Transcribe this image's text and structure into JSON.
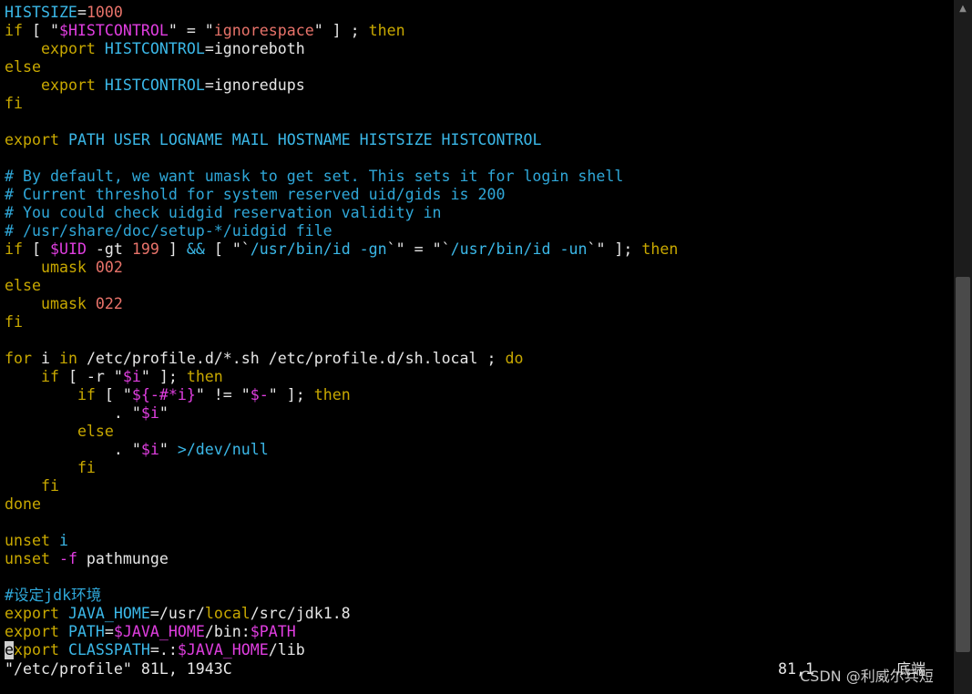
{
  "theme": {
    "background": "#000000",
    "colors": {
      "t": "#e6e6e6",
      "k": "#c8a800",
      "v": "#3bb8e8",
      "s": "#e8736a",
      "p": "#e03ee0",
      "n": "#e8736a",
      "c": "#2fa7d8",
      "o": "#cfcfcf"
    }
  },
  "editor": {
    "lines": [
      [
        [
          "v",
          "HISTSIZE"
        ],
        [
          "t",
          "="
        ],
        [
          "n",
          "1000"
        ]
      ],
      [
        [
          "k",
          "if"
        ],
        [
          "t",
          " [ \""
        ],
        [
          "p",
          "$HISTCONTROL"
        ],
        [
          "t",
          "\" = \""
        ],
        [
          "s",
          "ignorespace"
        ],
        [
          "t",
          "\" ] ; "
        ],
        [
          "k",
          "then"
        ]
      ],
      [
        [
          "t",
          "    "
        ],
        [
          "k",
          "export"
        ],
        [
          "t",
          " "
        ],
        [
          "v",
          "HISTCONTROL"
        ],
        [
          "t",
          "=ignoreboth"
        ]
      ],
      [
        [
          "k",
          "else"
        ]
      ],
      [
        [
          "t",
          "    "
        ],
        [
          "k",
          "export"
        ],
        [
          "t",
          " "
        ],
        [
          "v",
          "HISTCONTROL"
        ],
        [
          "t",
          "=ignoredups"
        ]
      ],
      [
        [
          "k",
          "fi"
        ]
      ],
      [],
      [
        [
          "k",
          "export"
        ],
        [
          "t",
          " "
        ],
        [
          "v",
          "PATH USER LOGNAME MAIL HOSTNAME HISTSIZE HISTCONTROL"
        ]
      ],
      [],
      [
        [
          "c",
          "# By default, we want umask to get set. This sets it for login shell"
        ]
      ],
      [
        [
          "c",
          "# Current threshold for system reserved uid/gids is 200"
        ]
      ],
      [
        [
          "c",
          "# You could check uidgid reservation validity in"
        ]
      ],
      [
        [
          "c",
          "# /usr/share/doc/setup-*/uidgid file"
        ]
      ],
      [
        [
          "k",
          "if"
        ],
        [
          "t",
          " [ "
        ],
        [
          "p",
          "$UID"
        ],
        [
          "t",
          " -gt "
        ],
        [
          "n",
          "199"
        ],
        [
          "t",
          " ] "
        ],
        [
          "v",
          "&&"
        ],
        [
          "t",
          " [ \"`"
        ],
        [
          "v",
          "/usr/bin/id -gn"
        ],
        [
          "t",
          "`\" = \"`"
        ],
        [
          "v",
          "/usr/bin/id -un"
        ],
        [
          "t",
          "`\" ]; "
        ],
        [
          "k",
          "then"
        ]
      ],
      [
        [
          "t",
          "    "
        ],
        [
          "k",
          "umask"
        ],
        [
          "t",
          " "
        ],
        [
          "n",
          "002"
        ]
      ],
      [
        [
          "k",
          "else"
        ]
      ],
      [
        [
          "t",
          "    "
        ],
        [
          "k",
          "umask"
        ],
        [
          "t",
          " "
        ],
        [
          "n",
          "022"
        ]
      ],
      [
        [
          "k",
          "fi"
        ]
      ],
      [],
      [
        [
          "k",
          "for"
        ],
        [
          "t",
          " i "
        ],
        [
          "k",
          "in"
        ],
        [
          "t",
          " /etc/profile.d/*.sh /etc/profile.d/sh.local ; "
        ],
        [
          "k",
          "do"
        ]
      ],
      [
        [
          "t",
          "    "
        ],
        [
          "k",
          "if"
        ],
        [
          "t",
          " [ -r \""
        ],
        [
          "p",
          "$i"
        ],
        [
          "t",
          "\" ]; "
        ],
        [
          "k",
          "then"
        ]
      ],
      [
        [
          "t",
          "        "
        ],
        [
          "k",
          "if"
        ],
        [
          "t",
          " [ \""
        ],
        [
          "p",
          "${-#*i}"
        ],
        [
          "t",
          "\" != \""
        ],
        [
          "p",
          "$-"
        ],
        [
          "t",
          "\" ]; "
        ],
        [
          "k",
          "then"
        ]
      ],
      [
        [
          "t",
          "            . \""
        ],
        [
          "p",
          "$i"
        ],
        [
          "t",
          "\""
        ]
      ],
      [
        [
          "t",
          "        "
        ],
        [
          "k",
          "else"
        ]
      ],
      [
        [
          "t",
          "            . \""
        ],
        [
          "p",
          "$i"
        ],
        [
          "t",
          "\" "
        ],
        [
          "v",
          ">/dev/null"
        ]
      ],
      [
        [
          "t",
          "        "
        ],
        [
          "k",
          "fi"
        ]
      ],
      [
        [
          "t",
          "    "
        ],
        [
          "k",
          "fi"
        ]
      ],
      [
        [
          "k",
          "done"
        ]
      ],
      [],
      [
        [
          "k",
          "unset"
        ],
        [
          "t",
          " "
        ],
        [
          "v",
          "i"
        ]
      ],
      [
        [
          "k",
          "unset"
        ],
        [
          "t",
          " "
        ],
        [
          "p",
          "-f"
        ],
        [
          "t",
          " pathmunge"
        ]
      ],
      [],
      [
        [
          "c",
          "#设定jdk环境"
        ]
      ],
      [
        [
          "k",
          "export"
        ],
        [
          "t",
          " "
        ],
        [
          "v",
          "JAVA_HOME"
        ],
        [
          "t",
          "=/usr/"
        ],
        [
          "k",
          "local"
        ],
        [
          "t",
          "/src/jdk1.8"
        ]
      ],
      [
        [
          "k",
          "export"
        ],
        [
          "t",
          " "
        ],
        [
          "v",
          "PATH"
        ],
        [
          "t",
          "="
        ],
        [
          "p",
          "$JAVA_HOME"
        ],
        [
          "t",
          "/bin:"
        ],
        [
          "p",
          "$PATH"
        ]
      ],
      [
        [
          "cursor",
          "e"
        ],
        [
          "k",
          "xport"
        ],
        [
          "t",
          " "
        ],
        [
          "v",
          "CLASSPATH"
        ],
        [
          "t",
          "=.:"
        ],
        [
          "p",
          "$JAVA_HOME"
        ],
        [
          "t",
          "/lib"
        ]
      ]
    ]
  },
  "status": {
    "file_info": "\"/etc/profile\" 81L, 1943C",
    "position": "81,1",
    "mode": "底端"
  },
  "watermark": "CSDN @利威尔兵短",
  "scrollbar": {
    "up_arrow_icon": "▲",
    "scroll_position": 1.0
  }
}
